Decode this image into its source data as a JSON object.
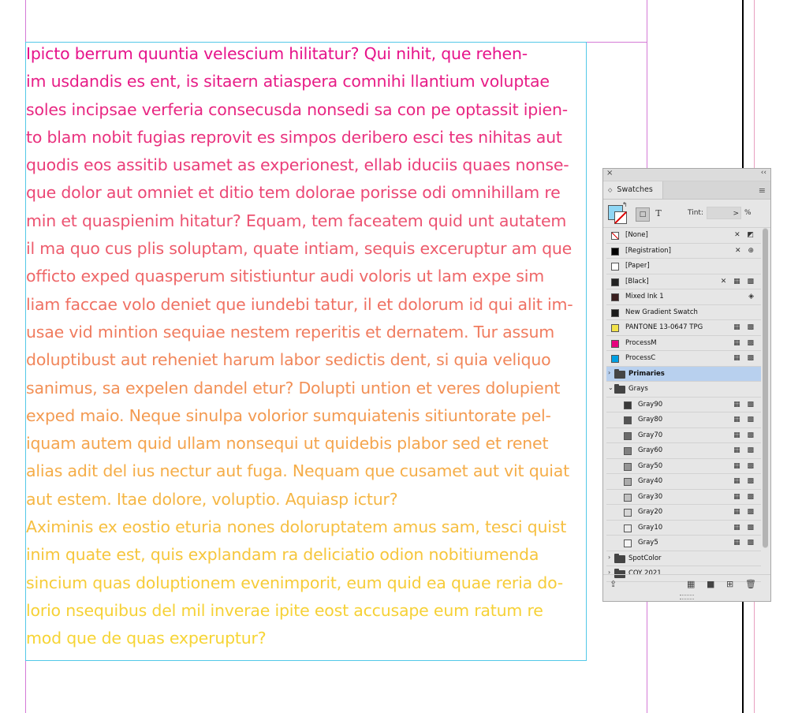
{
  "document": {
    "paragraph_lines": [
      {
        "text": "Ipicto berrum quuntia velescium hilitatur? Qui nihit, que rehen-",
        "color": "#e6138a"
      },
      {
        "text": "im usdandis es ent, is sitaern atiaspera comnihi llantium voluptae",
        "color": "#e71d86"
      },
      {
        "text": "soles incipsae verferia consecusda nonsedi sa con pe optassit ipien-",
        "color": "#e82782"
      },
      {
        "text": "to blam nobit fugias reprovit es simpos deribero esci tes nihitas aut",
        "color": "#e9327e"
      },
      {
        "text": "quodis eos assitib usamet as experionest, ellab iduciis quaes nonse-",
        "color": "#ea3d79"
      },
      {
        "text": "que dolor aut omniet et ditio tem dolorae porisse odi omnihillam re",
        "color": "#eb4775"
      },
      {
        "text": "min et quaspienim hitatur? Equam, tem faceatem quid unt autatem",
        "color": "#ec5271"
      },
      {
        "text": "il ma quo cus plis soluptam, quate intiam, sequis exceruptur am que",
        "color": "#ed5c6c"
      },
      {
        "text": "officto exped quasperum sitistiuntur audi voloris ut lam expe sim",
        "color": "#ee6768"
      },
      {
        "text": "liam faccae volo deniet que iundebi tatur, il et dolorum id qui alit im-",
        "color": "#ef7163"
      },
      {
        "text": "usae vid mintion sequiae nestem reperitis et dernatem. Tur assum",
        "color": "#f07c5f"
      },
      {
        "text": "doluptibust aut reheniet harum labor sedictis dent, si quia veliquo",
        "color": "#f1865a"
      },
      {
        "text": "sanimus, sa expelen dandel etur? Dolupti untion et veres dolupient",
        "color": "#f29056"
      },
      {
        "text": "exped maio. Neque sinulpa volorior sumquiatenis sitiuntorate pel-",
        "color": "#f39a51"
      },
      {
        "text": "iquam autem quid ullam nonsequi ut quidebis plabor sed et renet",
        "color": "#f4a44d"
      },
      {
        "text": "alias adit del ius nectur aut fuga. Nequam que cusamet aut vit quiat",
        "color": "#f5ad48"
      },
      {
        "text": "aut estem. Itae dolore, voluptio. Aquiasp ictur?",
        "color": "#f5b644"
      },
      {
        "text": "Aximinis ex eostio eturia nones doloruptatem amus sam, tesci quist",
        "color": "#f6bf40"
      },
      {
        "text": "inim quate est, quis explandam ra deliciatio odion nobitiumenda",
        "color": "#f6c63c"
      },
      {
        "text": "sincium quas doluptionem evenimporit, eum quid ea quae reria do-",
        "color": "#f6cc39"
      },
      {
        "text": "lorio nsequibus del mil inverae ipite eost accusape eum ratum re",
        "color": "#f6d136"
      },
      {
        "text": "mod que de quas experuptur?",
        "color": "#f6d434"
      }
    ]
  },
  "swatches_panel": {
    "close_glyph": "×",
    "collapse_glyph": "‹‹",
    "tab_label": "Swatches",
    "tab_glyph": "◇",
    "menu_glyph": "≡",
    "fill_color": "#8fd7f5",
    "swap_glyph": "↰",
    "container_glyph": "□",
    "text_glyph": "T",
    "tint_label": "Tint:",
    "tint_value": "",
    "tint_arrow": ">",
    "tint_unit": "%",
    "rows": [
      {
        "label": "[None]",
        "chip": "none",
        "indent": 0,
        "badges": "✕ ◩"
      },
      {
        "label": "[Registration]",
        "chip": "#000000",
        "indent": 0,
        "badges": "✕ ⊕"
      },
      {
        "label": "[Paper]",
        "chip": "#ffffff",
        "indent": 0,
        "badges": ""
      },
      {
        "label": "[Black]",
        "chip": "#222222",
        "indent": 0,
        "badges": "✕ ▦ ▩"
      },
      {
        "label": "Mixed Ink 1",
        "chip": "#3a1f1f",
        "indent": 0,
        "badges": "◈"
      },
      {
        "label": "New Gradient Swatch",
        "chip": "#1a1a1a",
        "indent": 0,
        "badges": ""
      },
      {
        "label": "PANTONE 13-0647 TPG",
        "chip": "#f2e24a",
        "indent": 0,
        "badges": "▦ ▩"
      },
      {
        "label": "ProcessM",
        "chip": "#e6007e",
        "indent": 0,
        "badges": "▦ ▩"
      },
      {
        "label": "ProcessC",
        "chip": "#00a0e3",
        "indent": 0,
        "badges": "▦ ▩"
      },
      {
        "label": "Primaries",
        "chip": "folder",
        "indent": 0,
        "badges": "",
        "disclosure": "›",
        "selected": true,
        "bold": true
      },
      {
        "label": "Grays",
        "chip": "folder",
        "indent": 0,
        "badges": "",
        "disclosure": "⌄"
      },
      {
        "label": "Gray90",
        "chip": "#3a3a3a",
        "indent": 1,
        "badges": "▦ ▩"
      },
      {
        "label": "Gray80",
        "chip": "#545454",
        "indent": 1,
        "badges": "▦ ▩"
      },
      {
        "label": "Gray70",
        "chip": "#6b6b6b",
        "indent": 1,
        "badges": "▦ ▩"
      },
      {
        "label": "Gray60",
        "chip": "#808080",
        "indent": 1,
        "badges": "▦ ▩"
      },
      {
        "label": "Gray50",
        "chip": "#959595",
        "indent": 1,
        "badges": "▦ ▩"
      },
      {
        "label": "Gray40",
        "chip": "#ababab",
        "indent": 1,
        "badges": "▦ ▩"
      },
      {
        "label": "Gray30",
        "chip": "#c1c1c1",
        "indent": 1,
        "badges": "▦ ▩"
      },
      {
        "label": "Gray20",
        "chip": "#d6d6d6",
        "indent": 1,
        "badges": "▦ ▩"
      },
      {
        "label": "Gray10",
        "chip": "#ebebeb",
        "indent": 1,
        "badges": "▦ ▩"
      },
      {
        "label": "Gray5",
        "chip": "#f5f5f5",
        "indent": 1,
        "badges": "▦ ▩"
      },
      {
        "label": "SpotColor",
        "chip": "folder",
        "indent": 0,
        "badges": "",
        "disclosure": "›"
      },
      {
        "label": "COY 2021",
        "chip": "folder",
        "indent": 0,
        "badges": "",
        "disclosure": "›"
      }
    ],
    "bottom_icons": {
      "import": "⇪",
      "show_kinds": "▦",
      "new_group": "■",
      "new_swatch": "⊞",
      "delete": "🗑"
    }
  },
  "colors": {
    "frame_edge": "#53c8e8",
    "margin_guide": "#d47ad6",
    "bleed_guide": "#e8a0c0",
    "selected_row": "#b8d0ee"
  }
}
